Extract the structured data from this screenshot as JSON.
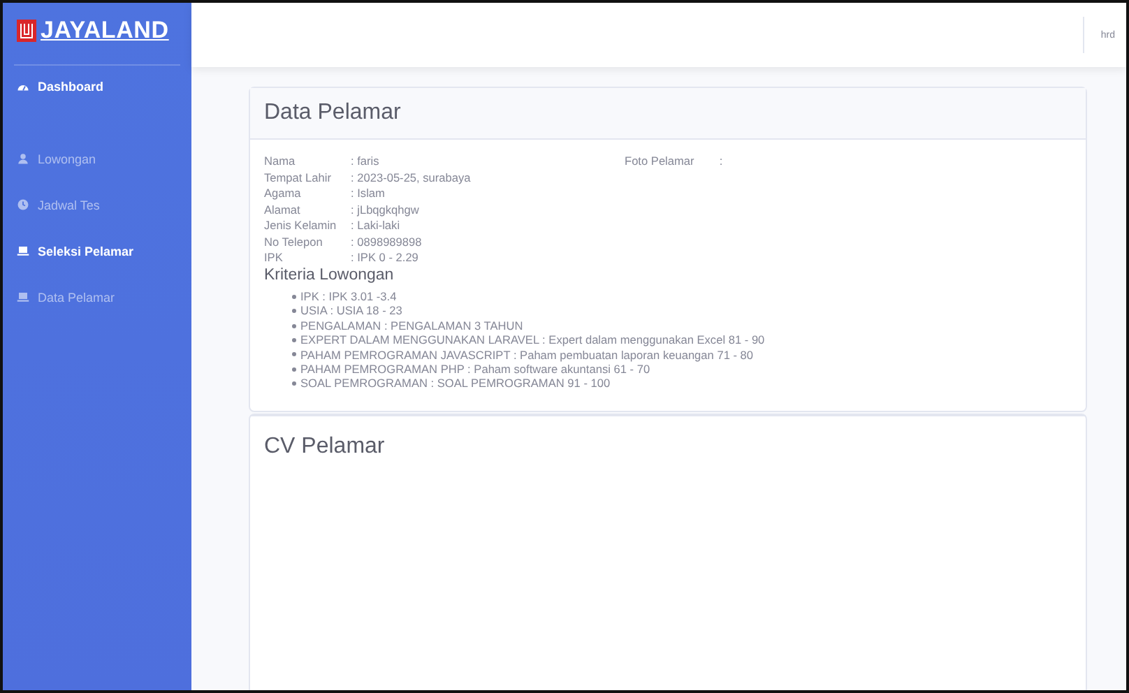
{
  "brand": {
    "name": "JAYALAND"
  },
  "sidebar": {
    "items": [
      {
        "label": "Dashboard",
        "selected": true
      },
      {
        "label": "Lowongan",
        "selected": false
      },
      {
        "label": "Jadwal Tes",
        "selected": false
      },
      {
        "label": "Seleksi Pelamar",
        "selected": true
      },
      {
        "label": "Data Pelamar",
        "selected": false
      }
    ]
  },
  "topbar": {
    "user": "hrd"
  },
  "applicant_card": {
    "title": "Data Pelamar",
    "fields": [
      {
        "label": "Nama",
        "value": ": faris"
      },
      {
        "label": "Tempat Lahir",
        "value": ": 2023-05-25,  surabaya"
      },
      {
        "label": "Agama",
        "value": ": Islam"
      },
      {
        "label": "Alamat",
        "value": ": jLbqgkqhgw"
      },
      {
        "label": "Jenis Kelamin",
        "value": ": Laki-laki"
      },
      {
        "label": "No Telepon",
        "value": ": 0898989898"
      },
      {
        "label": "IPK",
        "value": ": IPK 0 - 2.29"
      }
    ],
    "photo": {
      "label": "Foto Pelamar",
      "value": ":"
    },
    "criteria_title": "Kriteria Lowongan",
    "criteria": [
      "IPK : IPK 3.01 -3.4",
      "USIA : USIA 18 - 23",
      "PENGALAMAN : PENGALAMAN 3 TAHUN",
      "EXPERT DALAM MENGGUNAKAN LARAVEL : Expert dalam menggunakan Excel 81 - 90",
      "PAHAM PEMROGRAMAN JAVASCRIPT : Paham pembuatan laporan keuangan 71 - 80",
      "PAHAM PEMROGRAMAN PHP : Paham software akuntansi 61 - 70",
      "SOAL PEMROGRAMAN : SOAL PEMROGRAMAN 91 - 100"
    ]
  },
  "cv_card": {
    "title": "CV Pelamar"
  }
}
